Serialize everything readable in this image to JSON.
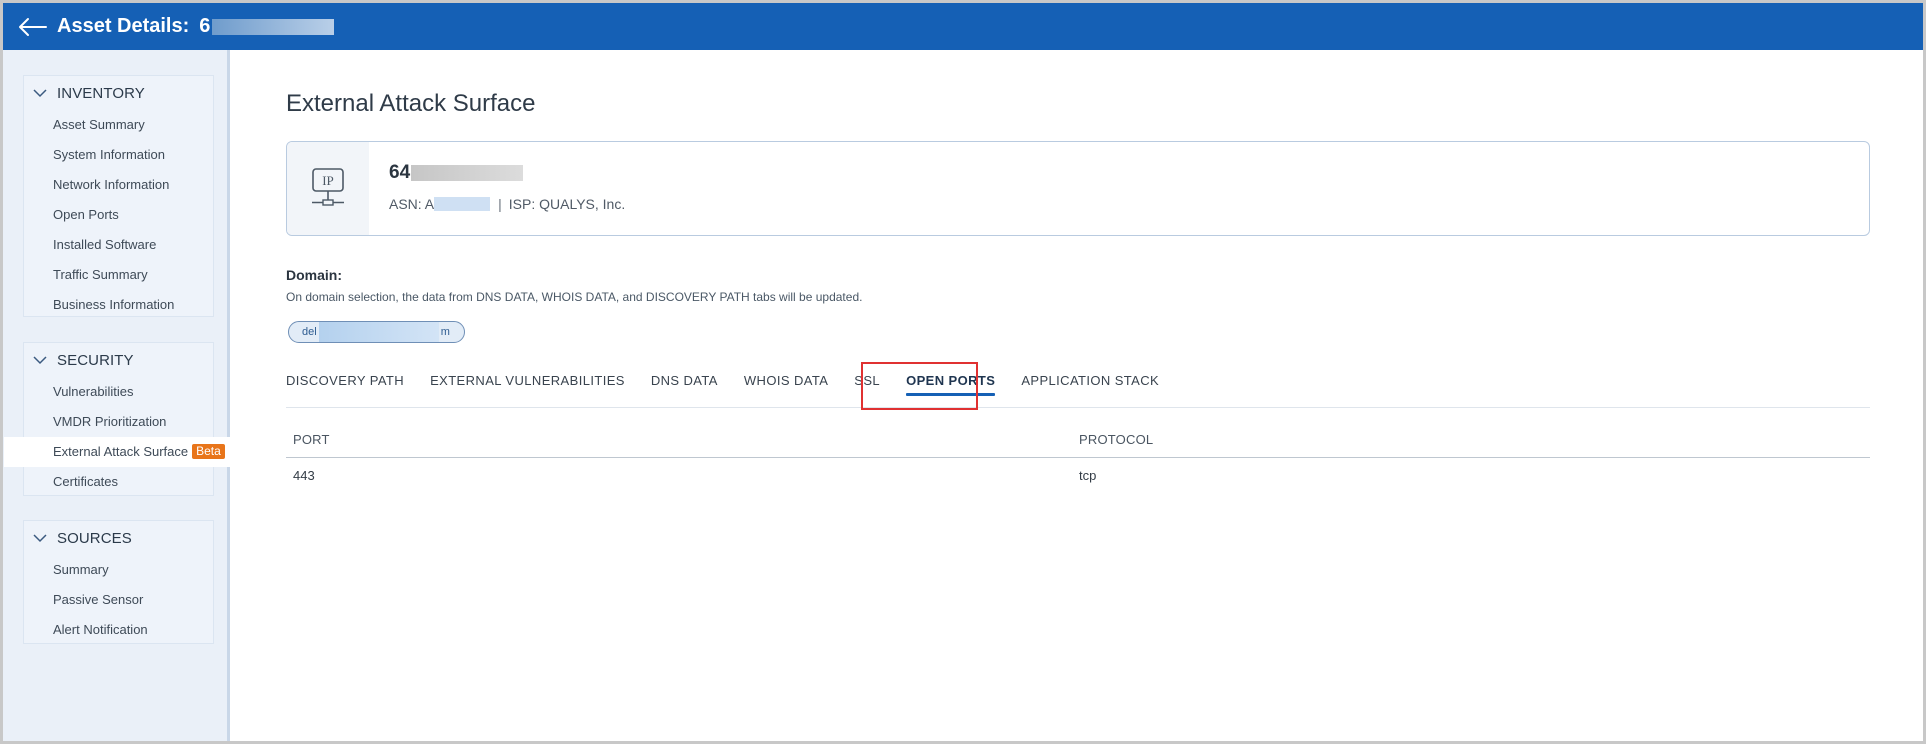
{
  "header": {
    "title": "Asset Details:",
    "asset_id_prefix": "6",
    "bg_color": "#1560b5"
  },
  "sidebar": {
    "sections": [
      {
        "title": "INVENTORY",
        "items": [
          {
            "label": "Asset Summary"
          },
          {
            "label": "System Information"
          },
          {
            "label": "Network Information"
          },
          {
            "label": "Open Ports"
          },
          {
            "label": "Installed Software"
          },
          {
            "label": "Traffic Summary"
          },
          {
            "label": "Business Information"
          }
        ]
      },
      {
        "title": "SECURITY",
        "items": [
          {
            "label": "Vulnerabilities"
          },
          {
            "label": "VMDR Prioritization"
          },
          {
            "label": "External Attack Surface",
            "badge": "Beta",
            "active": true
          },
          {
            "label": "Certificates"
          }
        ]
      },
      {
        "title": "SOURCES",
        "items": [
          {
            "label": "Summary"
          },
          {
            "label": "Passive Sensor"
          },
          {
            "label": "Alert Notification"
          }
        ]
      }
    ]
  },
  "main": {
    "page_title": "External Attack Surface",
    "ip_card": {
      "icon_text": "IP",
      "ip_prefix": "64",
      "asn_label": "ASN: A",
      "separator": "|",
      "isp": "ISP: QUALYS, Inc."
    },
    "domain": {
      "label": "Domain:",
      "help": "On domain selection, the data from DNS DATA, WHOIS DATA, and DISCOVERY PATH tabs will be updated.",
      "chip_prefix": "del",
      "chip_suffix": "m"
    },
    "tabs": [
      {
        "label": "DISCOVERY PATH"
      },
      {
        "label": "EXTERNAL VULNERABILITIES"
      },
      {
        "label": "DNS DATA"
      },
      {
        "label": "WHOIS DATA"
      },
      {
        "label": "SSL"
      },
      {
        "label": "OPEN PORTS",
        "active": true
      },
      {
        "label": "APPLICATION STACK"
      }
    ],
    "table": {
      "columns": [
        "PORT",
        "PROTOCOL"
      ],
      "rows": [
        [
          "443",
          "tcp"
        ]
      ]
    }
  },
  "colors": {
    "accent": "#1560b5",
    "beta_badge": "#e8751a",
    "highlight_box": "#e03131"
  }
}
